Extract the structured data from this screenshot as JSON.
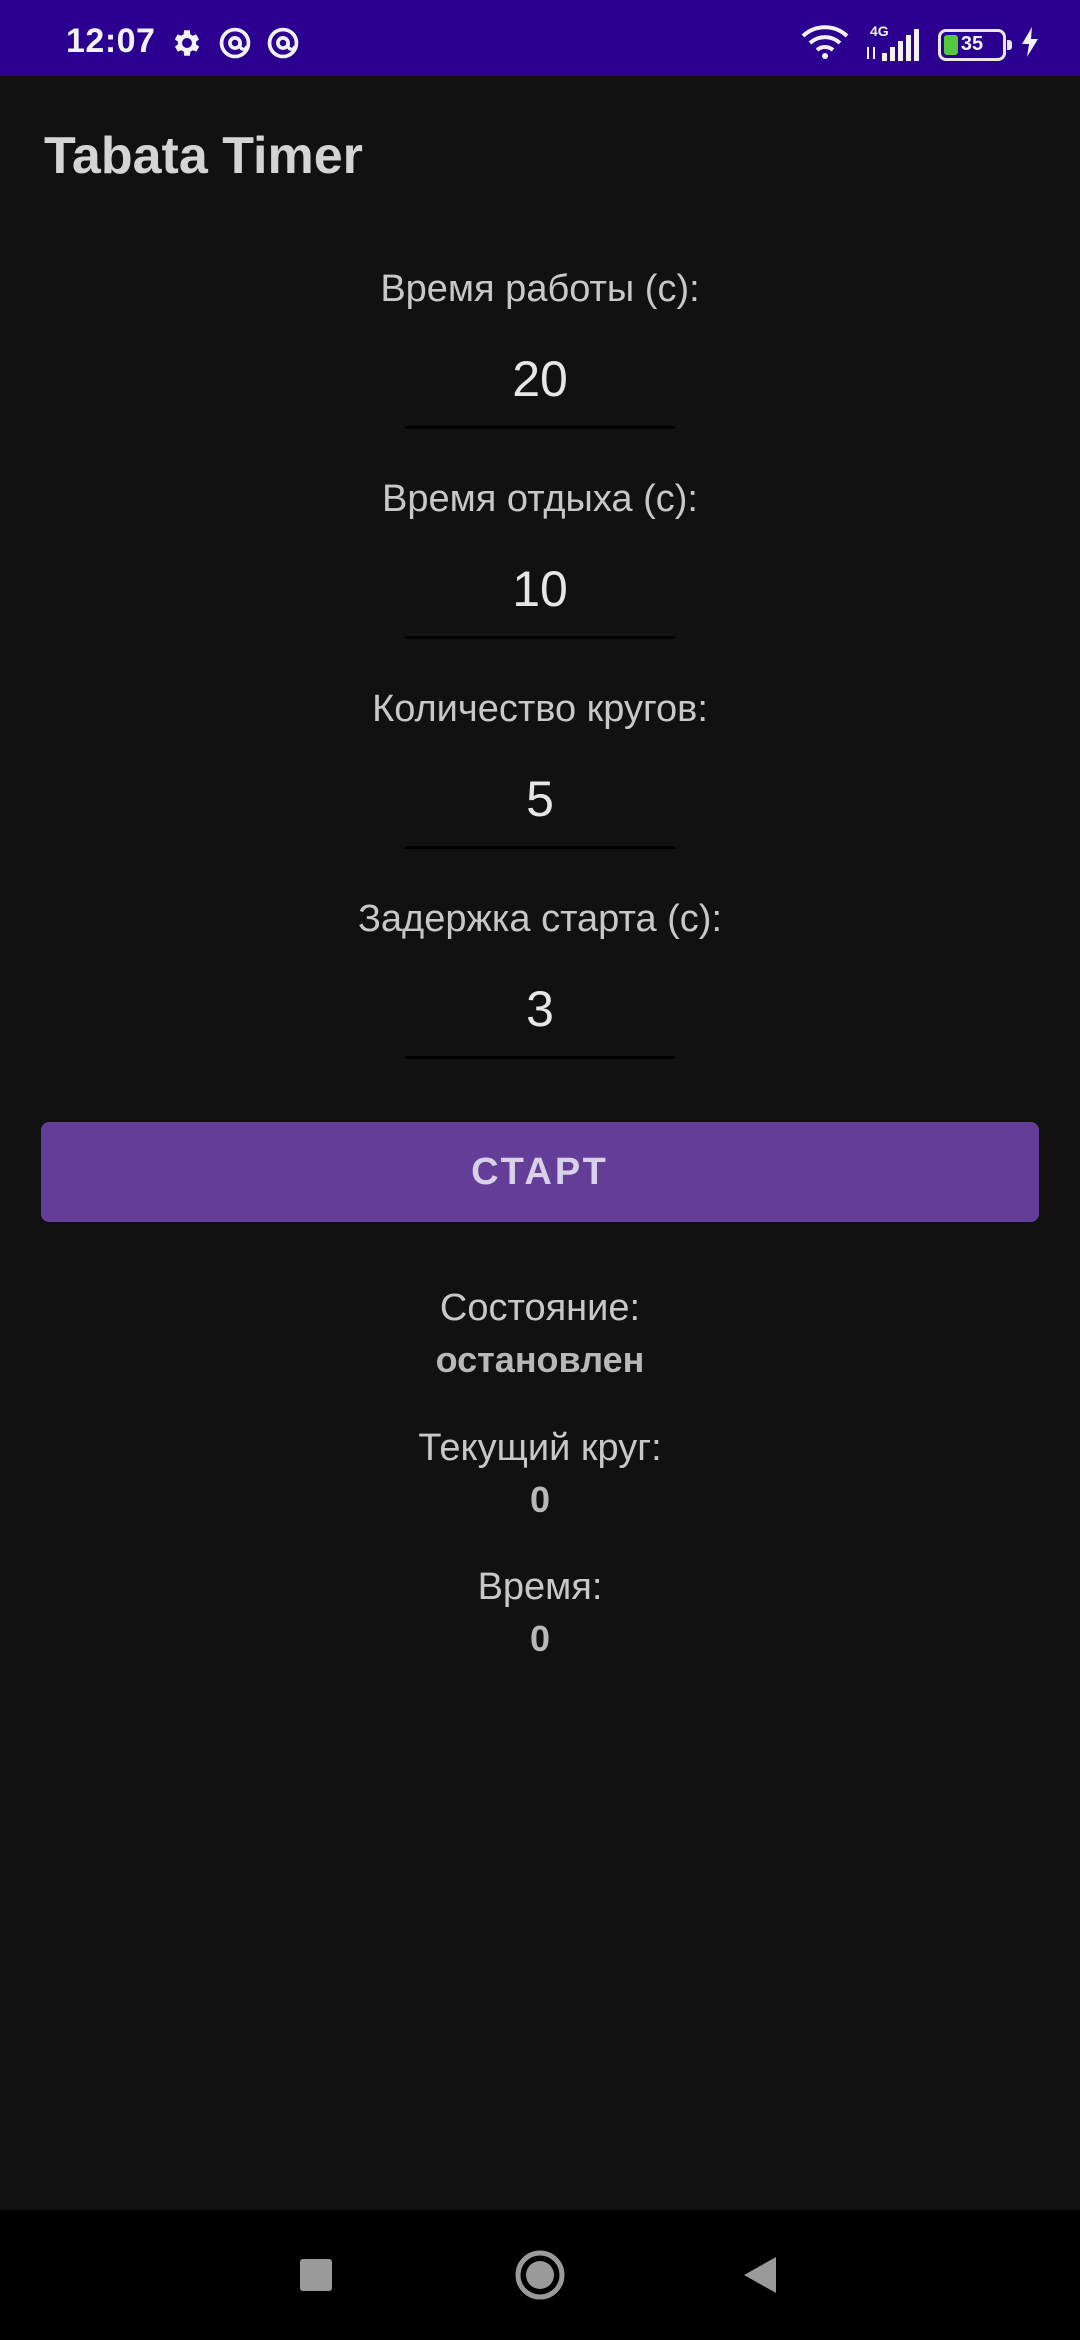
{
  "status_bar": {
    "time": "12:07",
    "left_icons": [
      "gear-icon",
      "at-sign-icon",
      "at-sign-icon"
    ],
    "network": "4G",
    "battery": "35"
  },
  "app": {
    "title": "Tabata Timer"
  },
  "fields": [
    {
      "label": "Время работы (с):",
      "value": "20"
    },
    {
      "label": "Время отдыха (с):",
      "value": "10"
    },
    {
      "label": "Количество кругов:",
      "value": "5"
    },
    {
      "label": "Задержка старта (с):",
      "value": "3"
    }
  ],
  "start_button": {
    "label": "СТАРТ",
    "color": "#643d98"
  },
  "info": [
    {
      "label": "Состояние:",
      "value": "остановлен"
    },
    {
      "label": "Текущий круг:",
      "value": "0"
    },
    {
      "label": "Время:",
      "value": "0"
    }
  ],
  "nav": [
    "recents-icon",
    "home-icon",
    "back-icon"
  ]
}
